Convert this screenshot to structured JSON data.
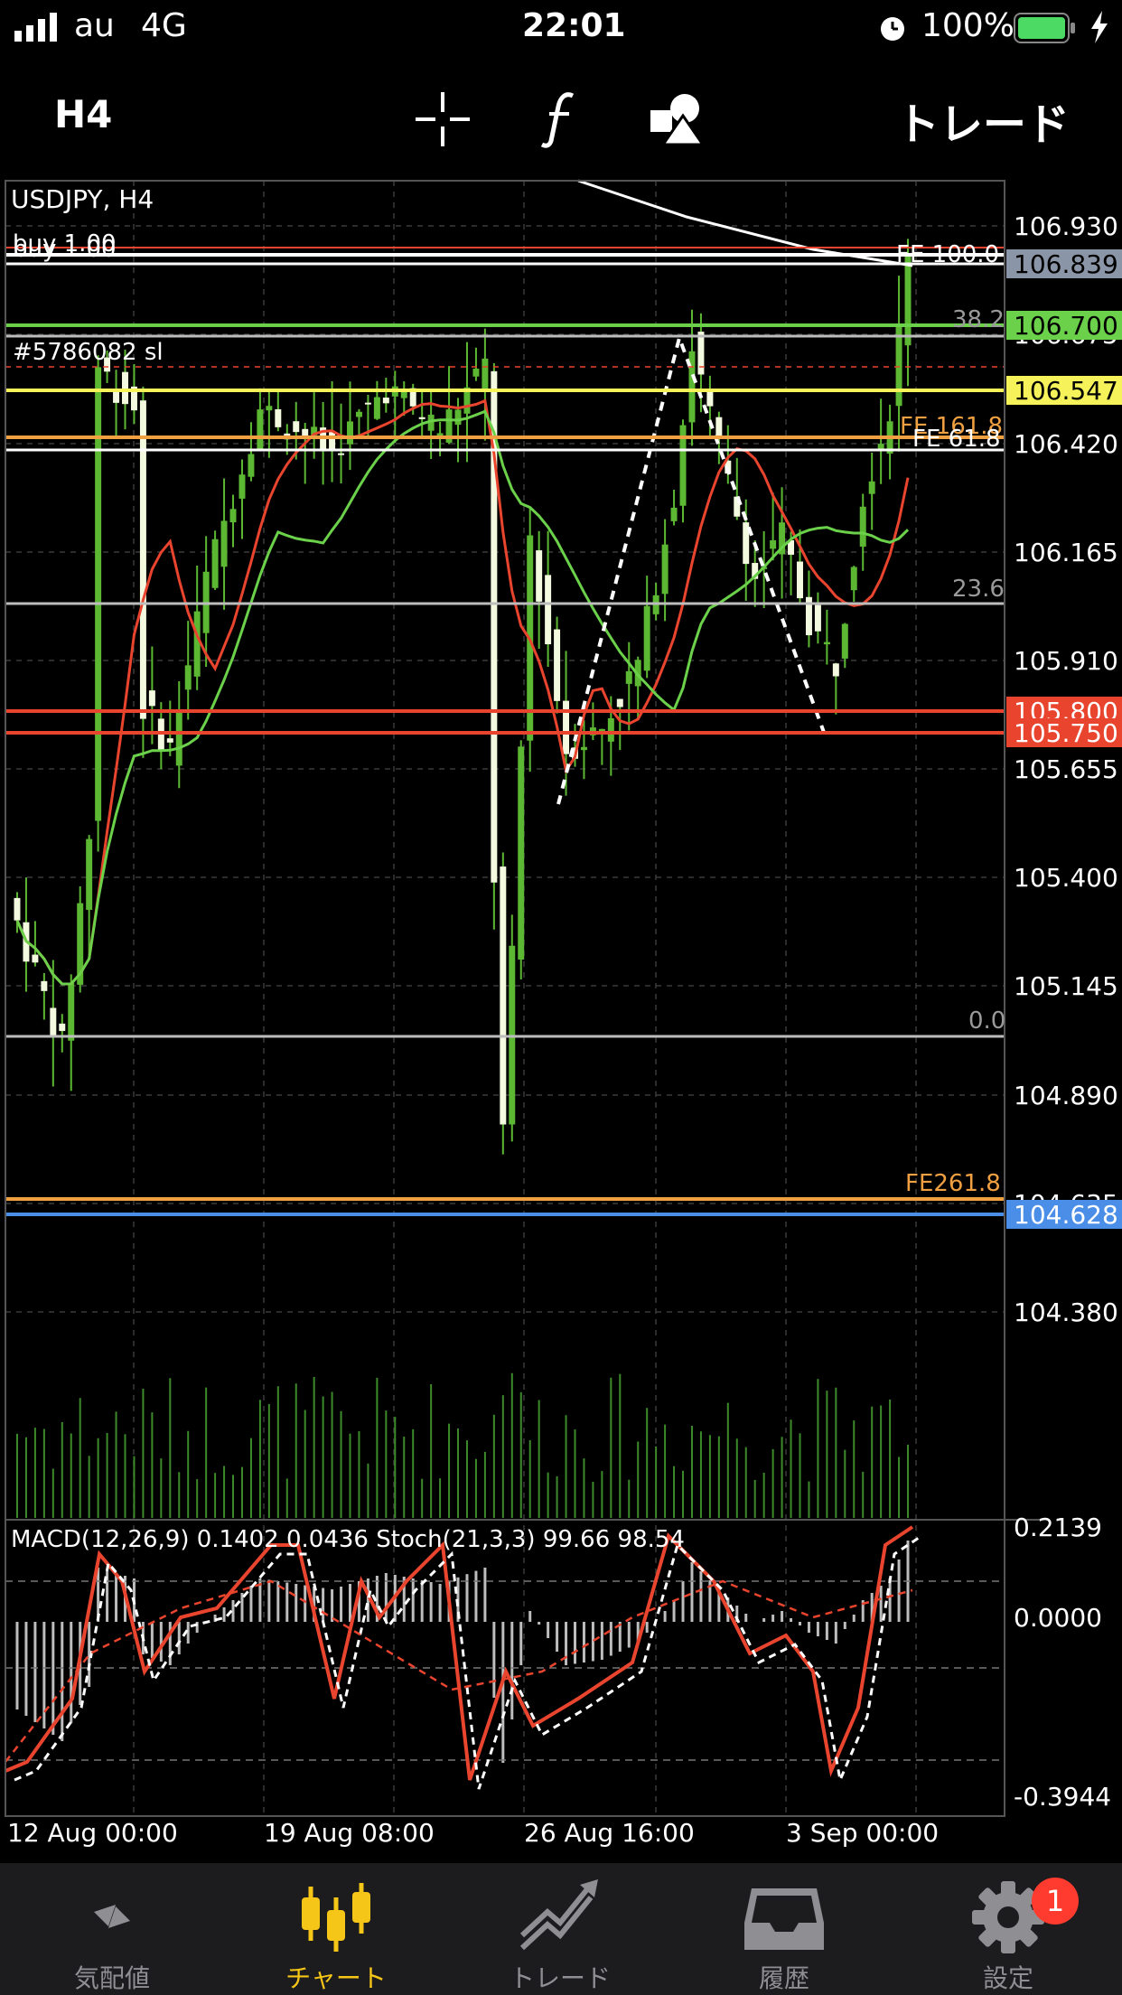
{
  "status_bar": {
    "carrier": "au",
    "network": "4G",
    "time": "22:01",
    "battery": "100%"
  },
  "toolbar": {
    "timeframe": "H4",
    "crosshair_icon": "crosshair-icon",
    "indicators_icon": "function-icon",
    "objects_icon": "shapes-icon",
    "trade_label": "トレード"
  },
  "chart_data": {
    "type": "candlestick",
    "symbol_label": "USDJPY, H4",
    "order_labels": [
      "buy 1.00",
      "buy 1.00"
    ],
    "ticket_label": "#5786082 sl",
    "price_axis": [
      "106.930",
      "106.675",
      "106.420",
      "106.165",
      "105.910",
      "105.655",
      "105.400",
      "105.145",
      "104.890",
      "104.635",
      "104.380"
    ],
    "price_ylim": [
      104.2,
      107.05
    ],
    "time_labels": [
      "12 Aug 00:00",
      "19 Aug 08:00",
      "26 Aug 16:00",
      "3 Sep 00:00"
    ],
    "highlighted_prices": [
      {
        "label": "106.839",
        "color": "#8a96a8",
        "text_color": "#000000"
      },
      {
        "label": "106.700",
        "color": "#6bd14a",
        "text_color": "#000000"
      },
      {
        "label": "106.547",
        "color": "#f5f25a",
        "text_color": "#000000"
      },
      {
        "label": "105.800",
        "color": "#e8442e",
        "text_color": "#ffffff"
      },
      {
        "label": "105.750",
        "color": "#e8442e",
        "text_color": "#ffffff"
      },
      {
        "label": "104.628",
        "color": "#4a8ee8",
        "text_color": "#ffffff"
      }
    ],
    "fib_labels": [
      {
        "text": "FE 100.0",
        "color": "#ffffff"
      },
      {
        "text": "38.2",
        "color": "#9a9a9a"
      },
      {
        "text": "FE 161.8",
        "color": "#f0a040"
      },
      {
        "text": "FE 61.8",
        "color": "#ffffff"
      },
      {
        "text": "23.6",
        "color": "#9a9a9a"
      },
      {
        "text": "0.0",
        "color": "#9a9a9a"
      },
      {
        "text": "FE261.8",
        "color": "#f0a040"
      }
    ],
    "indicator_label": "MACD(12,26,9) 0.1402 0.0436 Stoch(21,3,3) 99.66 98.54",
    "indicator_axis": [
      "0.2139",
      "0.0000",
      "-0.3944"
    ],
    "colors": {
      "up": "#5cb832",
      "down": "#f4fae0",
      "ma_fast": "#e8442e",
      "ma_slow": "#6bd14a",
      "ma_long": "#ffffff",
      "grid": "#3a3a3a",
      "volume": "#3c8a2a",
      "histogram": "#bdbdbd"
    }
  },
  "tabs": [
    {
      "label": "気配値",
      "icon": "quotes-icon",
      "active": false
    },
    {
      "label": "チャート",
      "icon": "chart-icon",
      "active": true
    },
    {
      "label": "トレード",
      "icon": "trade-icon",
      "active": false
    },
    {
      "label": "履歴",
      "icon": "history-icon",
      "active": false
    },
    {
      "label": "設定",
      "icon": "settings-icon",
      "active": false
    }
  ],
  "settings_badge": "1"
}
